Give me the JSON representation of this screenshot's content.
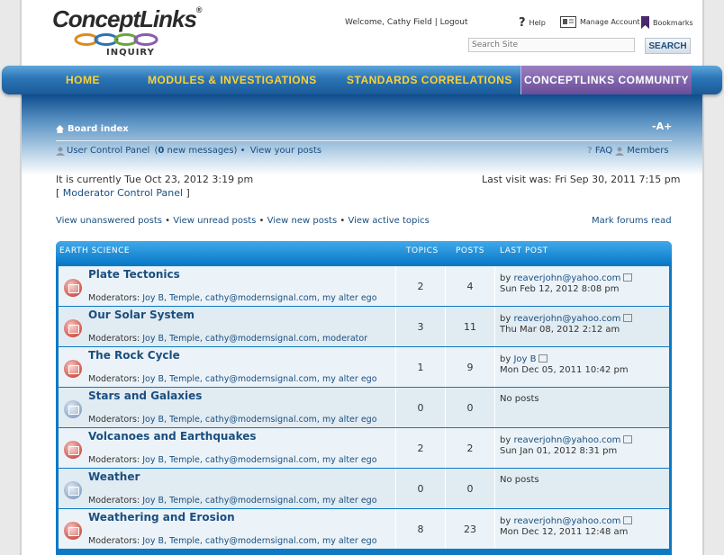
{
  "header": {
    "logo_text": "ConceptLinks",
    "logo_reg": "®",
    "logo_sub": "INQUIRY",
    "welcome": "Welcome, Cathy Field",
    "logout": "Logout",
    "help": "Help",
    "manage_account": "Manage Account",
    "bookmarks": "Bookmarks",
    "search_placeholder": "Search Site",
    "search_button": "SEARCH"
  },
  "nav": {
    "home": "HOME",
    "modules": "MODULES & INVESTIGATIONS",
    "standards": "STANDARDS CORRELATIONS",
    "community": "CONCEPTLINKS COMMUNITY"
  },
  "board": {
    "breadcrumb": "Board index",
    "fontsize": "-A+",
    "ucp": "User Control Panel",
    "messages_count": "0",
    "messages_suffix": "new messages",
    "view_posts": "View your posts",
    "faq": "FAQ",
    "members": "Members",
    "current_time": "It is currently Tue Oct 23, 2012 3:19 pm",
    "mod_cp": "Moderator Control Panel",
    "last_visit": "Last visit was: Fri Sep 30, 2011 7:15 pm",
    "link_unanswered": "View unanswered posts",
    "link_unread": "View unread posts",
    "link_new": "View new posts",
    "link_active": "View active topics",
    "mark_read": "Mark forums read"
  },
  "forum": {
    "category": "EARTH SCIENCE",
    "col_topics": "TOPICS",
    "col_posts": "POSTS",
    "col_last": "LAST POST",
    "mods_label": "Moderators:",
    "by_label": "by",
    "no_posts": "No posts",
    "rows": [
      {
        "title": "Plate Tectonics",
        "mods": "Joy B, Temple, cathy@modernsignal.com, my alter ego",
        "topics": "2",
        "posts": "4",
        "last_user": "reaverjohn@yahoo.com",
        "last_date": "Sun Feb 12, 2012 8:08 pm",
        "unread": true
      },
      {
        "title": "Our Solar System",
        "mods": "Joy B, Temple, cathy@modernsignal.com, moderator",
        "topics": "3",
        "posts": "11",
        "last_user": "reaverjohn@yahoo.com",
        "last_date": "Thu Mar 08, 2012 2:12 am",
        "unread": true
      },
      {
        "title": "The Rock Cycle",
        "mods": "Joy B, Temple, cathy@modernsignal.com, my alter ego",
        "topics": "1",
        "posts": "9",
        "last_user": "Joy B",
        "last_date": "Mon Dec 05, 2011 10:42 pm",
        "unread": true
      },
      {
        "title": "Stars and Galaxies",
        "mods": "Joy B, Temple, cathy@modernsignal.com, my alter ego",
        "topics": "0",
        "posts": "0",
        "last_user": "",
        "last_date": "",
        "unread": false
      },
      {
        "title": "Volcanoes and Earthquakes",
        "mods": "Joy B, Temple, cathy@modernsignal.com, my alter ego",
        "topics": "2",
        "posts": "2",
        "last_user": "reaverjohn@yahoo.com",
        "last_date": "Sun Jan 01, 2012 8:31 pm",
        "unread": true
      },
      {
        "title": "Weather",
        "mods": "Joy B, Temple, cathy@modernsignal.com, my alter ego",
        "topics": "0",
        "posts": "0",
        "last_user": "",
        "last_date": "",
        "unread": false
      },
      {
        "title": "Weathering and Erosion",
        "mods": "Joy B, Temple, cathy@modernsignal.com, my alter ego",
        "topics": "8",
        "posts": "23",
        "last_user": "reaverjohn@yahoo.com",
        "last_date": "Mon Dec 12, 2011 12:48 am",
        "unread": true
      }
    ]
  }
}
